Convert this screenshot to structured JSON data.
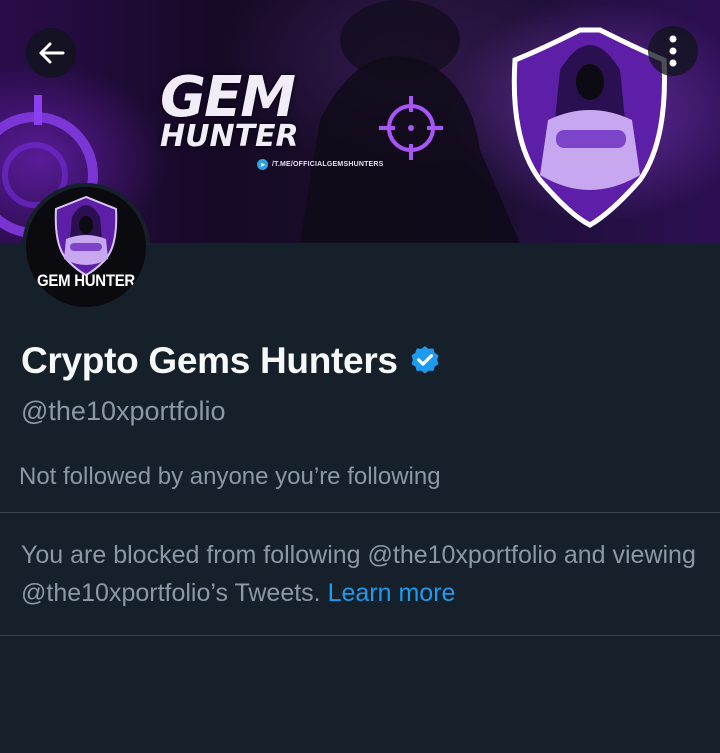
{
  "header": {
    "back_icon": "arrow-left-icon",
    "more_icon": "more-vertical-icon"
  },
  "banner": {
    "title_line1": "GEM",
    "title_line2": "HUNTER",
    "telegram_text": "/T.ME/OFFICIALGEMSHUNTERS",
    "accent_color": "#9b4dff"
  },
  "avatar": {
    "label": "GEM HUNTER"
  },
  "profile": {
    "name": "Crypto Gems Hunters",
    "verified_icon": "verified-badge-icon",
    "verified_color": "#1d9bf0",
    "handle": "@the10xportfolio",
    "followers_note": "Not followed by anyone you’re following"
  },
  "blocked": {
    "message": "You are blocked from following @the10xportfolio and viewing @the10xportfolio’s Tweets.",
    "learn_more_label": "Learn more"
  }
}
